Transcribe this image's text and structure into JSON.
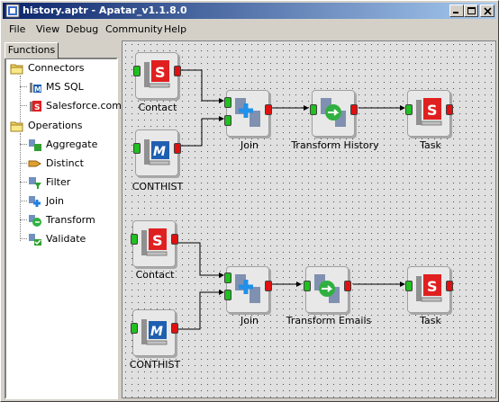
{
  "window": {
    "title": "history.aptr - Apatar_v1.1.8.0",
    "controls": [
      "minimize",
      "maximize",
      "close"
    ]
  },
  "menu": {
    "file": "File",
    "view": "View",
    "debug": "Debug",
    "community": "Community",
    "help": "Help"
  },
  "left_panel": {
    "tab": "Functions",
    "tree": {
      "connectors": {
        "label": "Connectors",
        "icon": "folder-icon",
        "items": [
          {
            "label": "MS SQL",
            "icon": "mssql-icon"
          },
          {
            "label": "Salesforce.com",
            "icon": "salesforce-icon"
          }
        ]
      },
      "operations": {
        "label": "Operations",
        "icon": "folder-icon",
        "items": [
          {
            "label": "Aggregate",
            "icon": "aggregate-icon"
          },
          {
            "label": "Distinct",
            "icon": "distinct-icon"
          },
          {
            "label": "Filter",
            "icon": "filter-icon"
          },
          {
            "label": "Join",
            "icon": "join-icon"
          },
          {
            "label": "Transform",
            "icon": "transform-icon"
          },
          {
            "label": "Validate",
            "icon": "validate-icon"
          }
        ]
      }
    }
  },
  "canvas": {
    "nodes": {
      "contact1": {
        "label": "Contact",
        "icon": "salesforce-icon"
      },
      "conthist1": {
        "label": "CONTHIST",
        "icon": "mssql-icon"
      },
      "join1": {
        "label": "Join",
        "icon": "join-icon"
      },
      "transform1": {
        "label": "Transform History",
        "icon": "transform-icon"
      },
      "task1": {
        "label": "Task",
        "icon": "salesforce-icon"
      },
      "contact2": {
        "label": "Contact",
        "icon": "salesforce-icon"
      },
      "conthist2": {
        "label": "CONTHIST",
        "icon": "mssql-icon"
      },
      "join2": {
        "label": "Join",
        "icon": "join-icon"
      },
      "transform2": {
        "label": "Transform Emails",
        "icon": "transform-icon"
      },
      "task2": {
        "label": "Task",
        "icon": "salesforce-icon"
      }
    },
    "colors": {
      "input_port": "#20c020",
      "output_port": "#e01010",
      "salesforce": "#e02020",
      "mssql": "#1f5fb0"
    }
  }
}
